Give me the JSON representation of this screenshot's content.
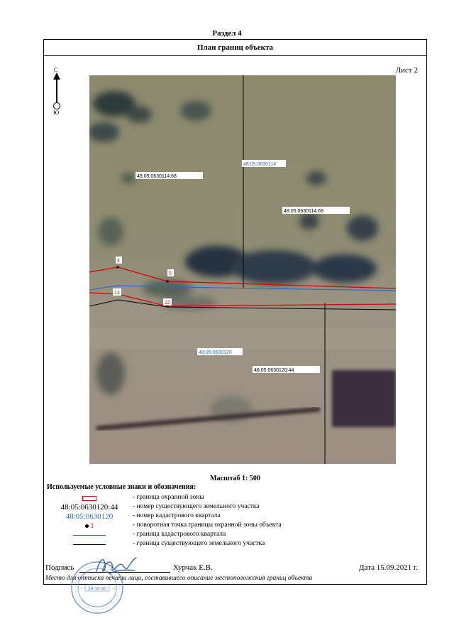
{
  "section_title": "Раздел 4",
  "plan_title": "План границ объекта",
  "sheet_label": "Лист 2",
  "compass": {
    "north": "С",
    "south": "Ю"
  },
  "map": {
    "parcel_1": "48:05:0630114:68",
    "quarter_1": "48:05:0630114",
    "parcel_2": "48:05:0630114:69",
    "point_4": "4",
    "point_5": "5",
    "point_13": "13",
    "point_12": "12",
    "quarter_2": "48:05:0630120",
    "parcel_3": "48:05:0630120:44",
    "colors": {
      "protect_zone": "#e00000",
      "quarter_border": "#2a6ad0",
      "parcel_border": "#000000"
    }
  },
  "scale": "Масштаб 1: 500",
  "legend": {
    "title": "Используемые условные знаки и обозначения:",
    "items": [
      {
        "symbol": "",
        "text": "- граница охранной зоны"
      },
      {
        "symbol": "48:05:0630120:44",
        "text": "- номер существующего земельного участка"
      },
      {
        "symbol": "48:05:0630120",
        "text": "- номер кадастрового квартала"
      },
      {
        "symbol": "1",
        "text": "- поворотная точка границы охранной зоны объекта"
      },
      {
        "symbol": "",
        "text": "- граница кадастрового квартала"
      },
      {
        "symbol": "",
        "text": "- граница существующего земельного участка"
      }
    ]
  },
  "signature": {
    "label": "Подпись",
    "name": "Хурчак Е.В.",
    "date": "Дата 15.09.2021 г."
  },
  "note": "Место для оттиска печати лица, составившего описание местоположения границ объекта",
  "stamp": {
    "text": "36-10-40"
  }
}
